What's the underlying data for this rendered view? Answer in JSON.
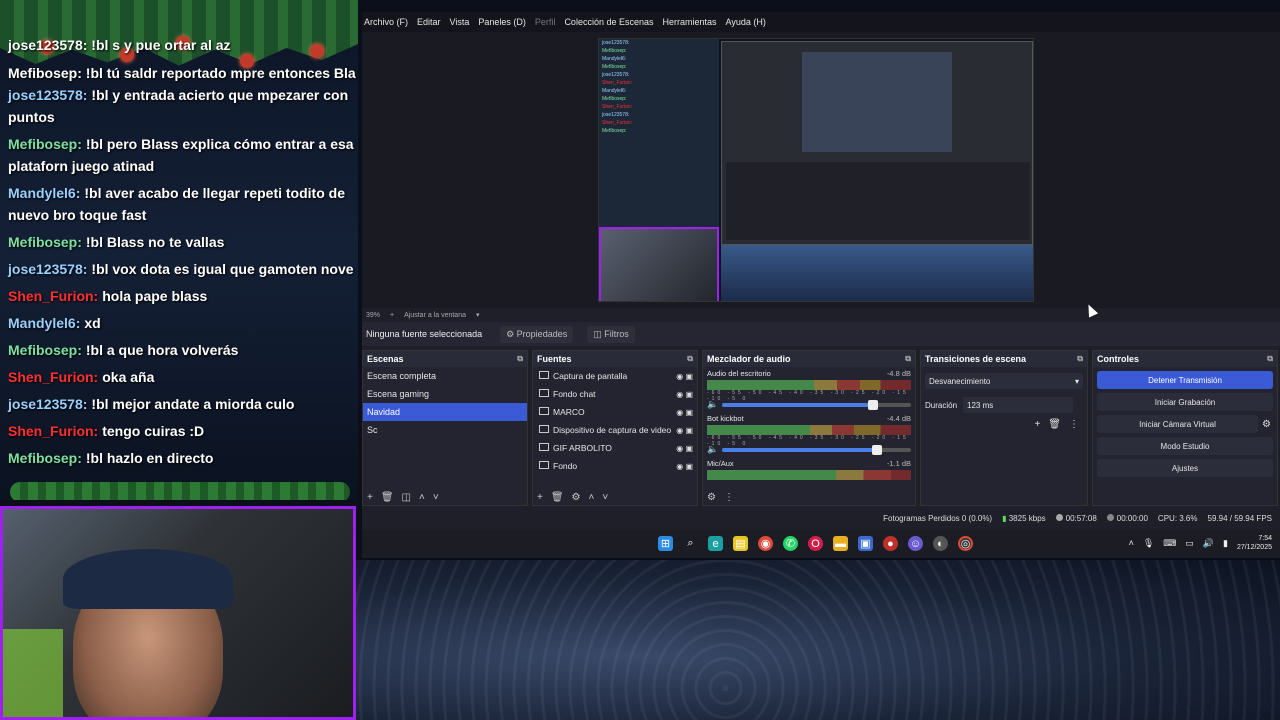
{
  "chat": {
    "top_fragment_1": "jose123578: !bl s y pue ortar al az",
    "top_fragment_2": "Mefibosep: !bl tú saldr reportado mpre entonces Bla",
    "messages": [
      {
        "user": "jose123578:",
        "text": "!bl y entrada acierto que mpezarer con puntos",
        "color": "#9ad0ff"
      },
      {
        "user": "Mefibosep:",
        "text": "!bl pero Blass explica cómo entrar a esa plataforn juego atinad",
        "color": "#7ee0a0"
      },
      {
        "user": "Mandylel6:",
        "text": "!bl aver acabo de llegar repeti todito de nuevo bro toque fast",
        "color": "#9ad0ff"
      },
      {
        "user": "Mefibosep:",
        "text": "!bl Blass no te vallas",
        "color": "#7ee0a0"
      },
      {
        "user": "jose123578:",
        "text": "!bl vox dota es igual que gamoten nove",
        "color": "#9ad0ff"
      },
      {
        "user": "Shen_Furion:",
        "text": "hola pape blass",
        "color": "#ff3030"
      },
      {
        "user": "Mandylel6:",
        "text": "xd",
        "color": "#9ad0ff"
      },
      {
        "user": "Mefibosep:",
        "text": "!bl a que hora volverás",
        "color": "#7ee0a0"
      },
      {
        "user": "Shen_Furion:",
        "text": "oka aña",
        "color": "#ff3030"
      },
      {
        "user": "jose123578:",
        "text": "!bl mejor andate a miorda culo",
        "color": "#9ad0ff"
      },
      {
        "user": "Shen_Furion:",
        "text": "tengo cuiras :D",
        "color": "#ff3030"
      },
      {
        "user": "Mefibosep:",
        "text": "!bl hazlo en directo",
        "color": "#7ee0a0"
      }
    ]
  },
  "obs": {
    "menu": [
      "Archivo (F)",
      "Editar",
      "Vista",
      "Paneles (D)",
      "Perfil",
      "Colección de Escenas",
      "Herramientas",
      "Ayuda (H)"
    ],
    "menu_dim_index": 4,
    "zoom": {
      "percent": "39%",
      "fit": "Ajustar a la ventana"
    },
    "source_bar": {
      "label": "Ninguna fuente seleccionada",
      "props": "Propiedades",
      "filters": "Filtros"
    },
    "scenes": {
      "title": "Escenas",
      "items": [
        "Escena completa",
        "Escena gaming",
        "Navidad",
        "Sc"
      ],
      "selected": 2
    },
    "sources": {
      "title": "Fuentes",
      "items": [
        "Captura de pantalla",
        "Fondo chat",
        "MARCO",
        "Dispositivo de captura de video",
        "GIF ARBOLITO",
        "Fondo"
      ]
    },
    "mixer": {
      "title": "Mezclador de audio",
      "channels": [
        {
          "name": "Audio del escritorio",
          "db": "-4.8 dB",
          "level": 0.75,
          "volume": 0.8
        },
        {
          "name": "Bot kickbot",
          "db": "-4.4 dB",
          "level": 0.72,
          "volume": 0.82
        },
        {
          "name": "Mic/Aux",
          "db": "-1.1 dB",
          "level": 0.9,
          "volume": 0.9
        }
      ],
      "scale": "-60 -55 -50 -45 -40 -35 -30 -25 -20 -15 -10 -5 0"
    },
    "transitions": {
      "title": "Transiciones de escena",
      "selected": "Desvanecimiento",
      "duration_label": "Duración",
      "duration_value": "123 ms"
    },
    "controls": {
      "title": "Controles",
      "stop_stream": "Detener Transmisión",
      "start_record": "Iniciar Grabación",
      "virtual_cam": "Iniciar Cámara Virtual",
      "studio_mode": "Modo Estudio",
      "settings": "Ajustes"
    },
    "status": {
      "dropped": "Fotogramas Perdidos 0 (0.0%)",
      "bitrate": "3825 kbps",
      "live_time": "00:57:08",
      "rec_time": "00:00:00",
      "cpu": "CPU: 3.6%",
      "fps": "59.94 / 59.94 FPS"
    },
    "clock": {
      "time": "7:54",
      "date": "27/12/2025"
    }
  },
  "colors": {
    "accent": "#3b5bd6",
    "webcam_border": "#a020f0"
  }
}
